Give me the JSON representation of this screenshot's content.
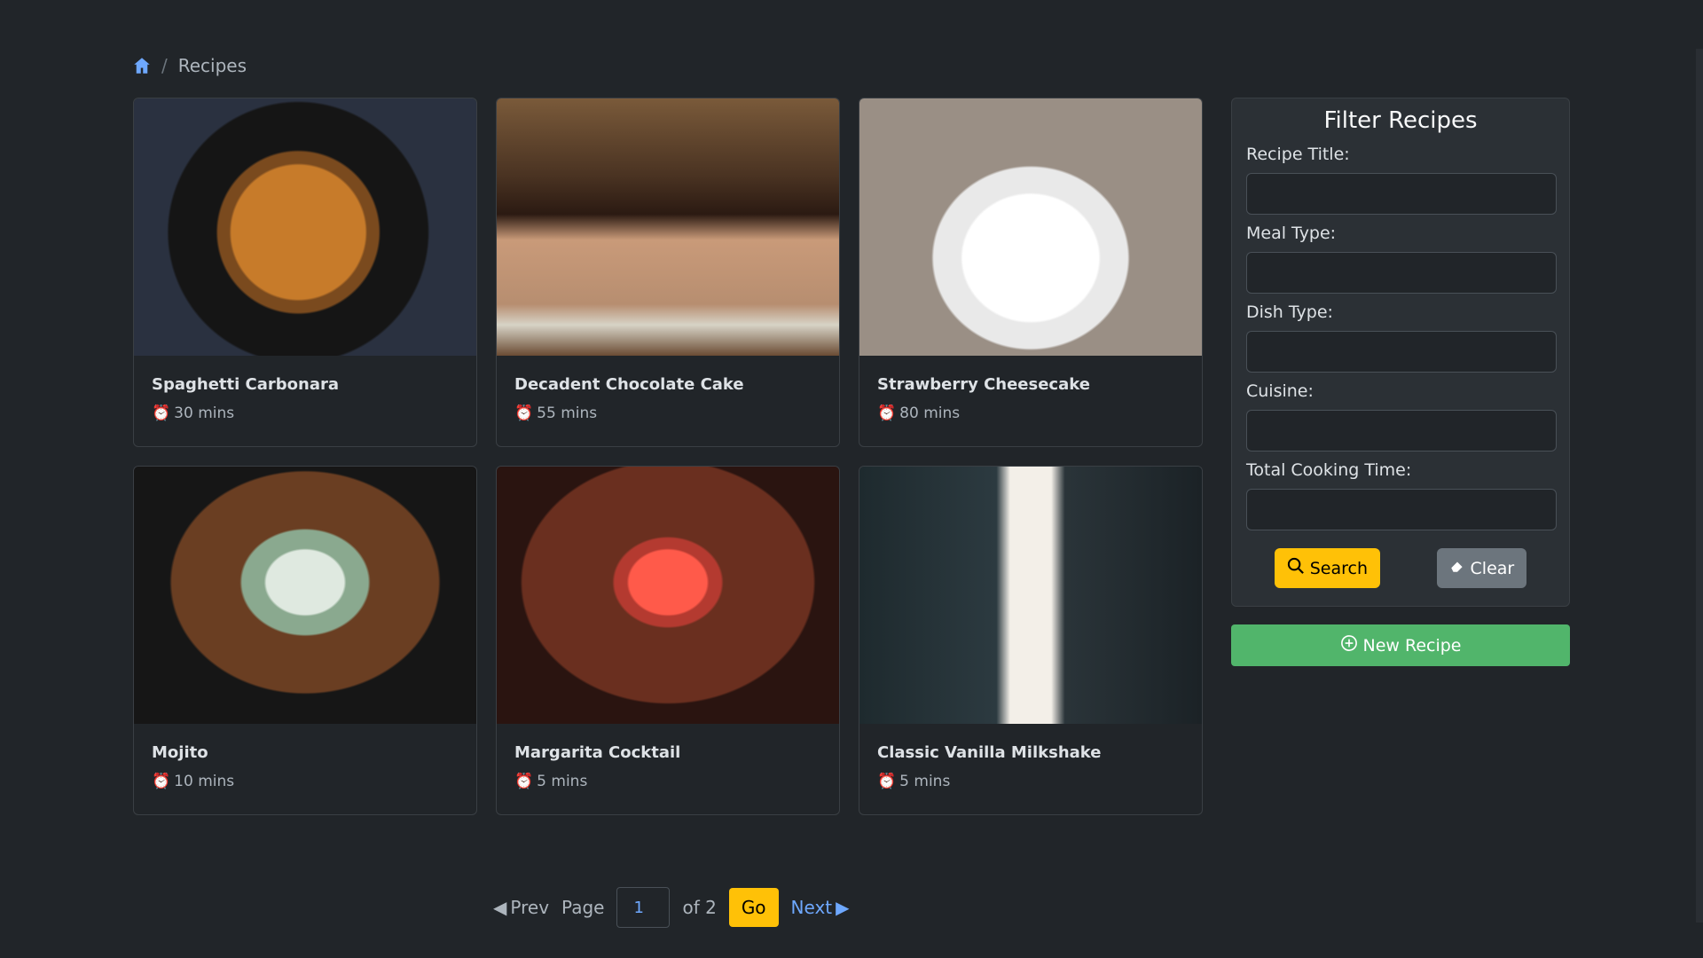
{
  "breadcrumb": {
    "current": "Recipes"
  },
  "recipes": [
    {
      "title": "Spaghetti Carbonara",
      "time": "30 mins",
      "image": "pasta"
    },
    {
      "title": "Decadent Chocolate Cake",
      "time": "55 mins",
      "image": "cake"
    },
    {
      "title": "Strawberry Cheesecake",
      "time": "80 mins",
      "image": "cheesecake"
    },
    {
      "title": "Mojito",
      "time": "10 mins",
      "image": "mojito"
    },
    {
      "title": "Margarita Cocktail",
      "time": "5 mins",
      "image": "margarita"
    },
    {
      "title": "Classic Vanilla Milkshake",
      "time": "5 mins",
      "image": "milkshake"
    }
  ],
  "filter": {
    "title": "Filter Recipes",
    "fields": [
      {
        "label": "Recipe Title:",
        "value": ""
      },
      {
        "label": "Meal Type:",
        "value": ""
      },
      {
        "label": "Dish Type:",
        "value": ""
      },
      {
        "label": "Cuisine:",
        "value": ""
      },
      {
        "label": "Total Cooking Time:",
        "value": ""
      }
    ],
    "search_label": "Search",
    "clear_label": "Clear"
  },
  "new_recipe_label": "New Recipe",
  "pagination": {
    "prev_label": "Prev",
    "page_label": "Page",
    "current_page": "1",
    "of_label": "of 2",
    "go_label": "Go",
    "next_label": "Next"
  },
  "colors": {
    "background": "#212529",
    "accent_warning": "#ffc107",
    "accent_success": "#51b56b",
    "link": "#6ea8fe",
    "secondary": "#6c757d"
  },
  "icons": {
    "home": "home-icon",
    "clock": "alarm-clock-icon",
    "search": "search-icon",
    "clear": "eraser-icon",
    "new": "plus-circle-icon",
    "prev": "caret-left-icon",
    "next": "caret-right-icon"
  }
}
